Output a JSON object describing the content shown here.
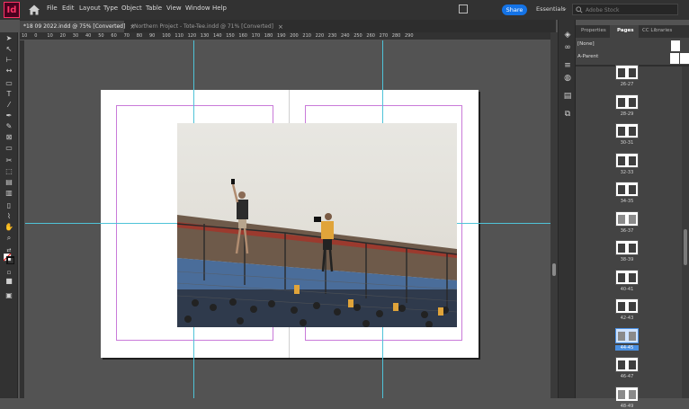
{
  "app": {
    "logo_text": "Id"
  },
  "menu": [
    "File",
    "Edit",
    "Layout",
    "Type",
    "Object",
    "Table",
    "View",
    "Window",
    "Help"
  ],
  "header": {
    "share_label": "Share",
    "workspace": "Essentials",
    "search_placeholder": "Adobe Stock"
  },
  "tabs": [
    {
      "label": "*18 09 2022.indd @ 75% [Converted]",
      "active": true
    },
    {
      "label": "*Northern Project - Tote-Tee.indd @ 71% [Converted]",
      "active": false
    }
  ],
  "ruler_top": [
    "10",
    "0",
    "10",
    "20",
    "30",
    "40",
    "50",
    "60",
    "70",
    "80",
    "90",
    "100",
    "110",
    "120",
    "130",
    "140",
    "150",
    "160",
    "170",
    "180",
    "190",
    "200",
    "210",
    "220",
    "230",
    "240",
    "250",
    "260",
    "270",
    "280",
    "290"
  ],
  "panel": {
    "tabs": [
      "Properties",
      "Pages",
      "CC Libraries"
    ],
    "parents": [
      {
        "label": "[None]"
      },
      {
        "label": "A-Parent"
      }
    ],
    "pages": [
      {
        "label": "26-27",
        "lite": false
      },
      {
        "label": "28-29",
        "lite": false
      },
      {
        "label": "30-31",
        "lite": false
      },
      {
        "label": "32-33",
        "lite": false
      },
      {
        "label": "34-35",
        "lite": false
      },
      {
        "label": "36-37",
        "lite": true
      },
      {
        "label": "38-39",
        "lite": false
      },
      {
        "label": "40-41",
        "lite": false
      },
      {
        "label": "42-43",
        "lite": false
      },
      {
        "label": "44-45",
        "lite": true,
        "selected": true
      },
      {
        "label": "46-47",
        "lite": false
      },
      {
        "label": "48-49",
        "lite": true
      }
    ]
  },
  "colors": {
    "accent": "#1473e6",
    "guide": "#4fc3d8",
    "margin": "#c97ad9",
    "app_brand": "#ff3366"
  }
}
